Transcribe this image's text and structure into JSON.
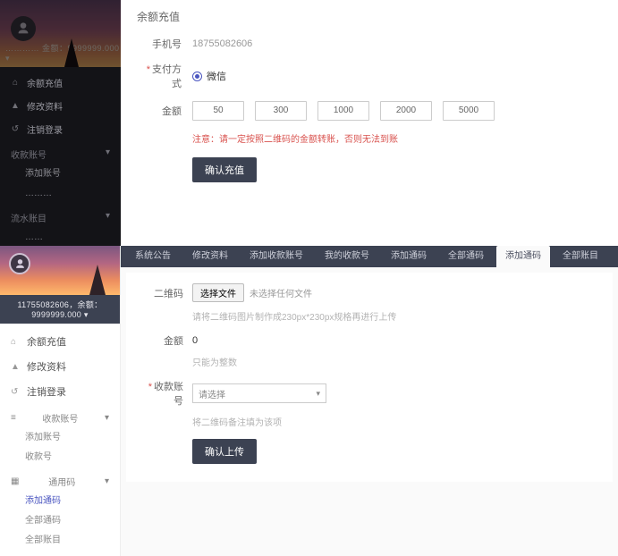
{
  "top": {
    "banner_userline": "………… 金额：9999999.000 ▾",
    "title": "余额充值",
    "phone_label": "手机号",
    "phone_value": "18755082606",
    "paytype_label": "支付方式",
    "paytype_value": "微信",
    "amount_label": "金额",
    "amounts": [
      "50",
      "300",
      "1000",
      "2000",
      "5000"
    ],
    "note": "注意：请一定按照二维码的金额转账，否则无法到账",
    "confirm": "确认充值",
    "menu": {
      "m1": "余额充值",
      "m2": "修改资料",
      "m3": "注销登录",
      "g1": "收款账号",
      "s1": "添加账号",
      "s2": "………",
      "g2": "流水账目",
      "s3": "……"
    }
  },
  "bottom": {
    "userline": "11755082606，余额：9999999.000 ▾",
    "menu": {
      "m1": "余额充值",
      "m2": "修改资料",
      "m3": "注销登录",
      "g1": "收款账号",
      "s1": "添加账号",
      "s2": "收款号",
      "g2": "通用码",
      "s3": "添加通码",
      "s4": "全部通码",
      "s5": "全部账目"
    },
    "nav": {
      "n1": "系统公告",
      "n2": "修改资料",
      "n3": "添加收款账号",
      "n4": "我的收款号",
      "n5": "添加通码",
      "n6": "全部通码",
      "n7": "添加通码",
      "n8": "全部账目"
    },
    "form": {
      "qr_label": "二维码",
      "choose": "选择文件",
      "nofile": "未选择任何文件",
      "qr_hint": "请将二维码图片制作成230px*230px规格再进行上传",
      "amount_label": "金额",
      "amount_value": "0",
      "amount_hint": "只能为整数",
      "acct_label": "收款账号",
      "acct_value": "请选择",
      "acct_hint": "将二维码备注填为该项",
      "submit": "确认上传"
    }
  }
}
